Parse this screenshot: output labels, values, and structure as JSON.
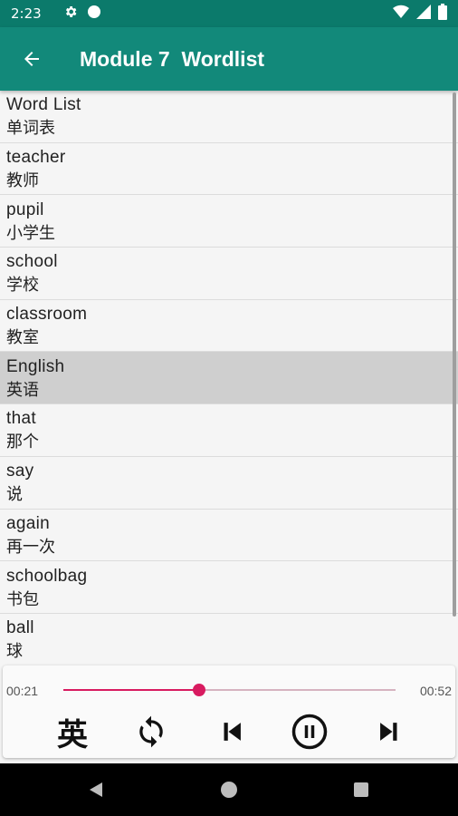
{
  "status_bar": {
    "time": "2:23",
    "icons": [
      "settings-icon",
      "circle-notification-icon",
      "wifi-icon",
      "signal-icon",
      "battery-icon"
    ]
  },
  "app_bar": {
    "title": "Module 7  Wordlist",
    "back_icon": "arrow-left-icon",
    "color": "#12897a"
  },
  "words": [
    {
      "en": "Word List",
      "cn": "单词表"
    },
    {
      "en": "teacher",
      "cn": "教师"
    },
    {
      "en": "pupil",
      "cn": "小学生"
    },
    {
      "en": "school",
      "cn": "学校"
    },
    {
      "en": "classroom",
      "cn": "教室"
    },
    {
      "en": "English",
      "cn": "英语"
    },
    {
      "en": "that",
      "cn": "那个"
    },
    {
      "en": "say",
      "cn": "说"
    },
    {
      "en": "again",
      "cn": "再一次"
    },
    {
      "en": "schoolbag",
      "cn": "书包"
    },
    {
      "en": "ball",
      "cn": "球"
    }
  ],
  "selected_index": 5,
  "player": {
    "current_time": "00:21",
    "total_time": "00:52",
    "progress": 0.41,
    "accent": "#d81b60",
    "lang_toggle_label": "英",
    "controls": [
      "language-toggle",
      "repeat-icon",
      "skip-previous-icon",
      "pause-icon",
      "skip-next-icon"
    ]
  },
  "nav_bar": {
    "buttons": [
      "back-triangle-icon",
      "home-circle-icon",
      "recents-square-icon"
    ]
  }
}
